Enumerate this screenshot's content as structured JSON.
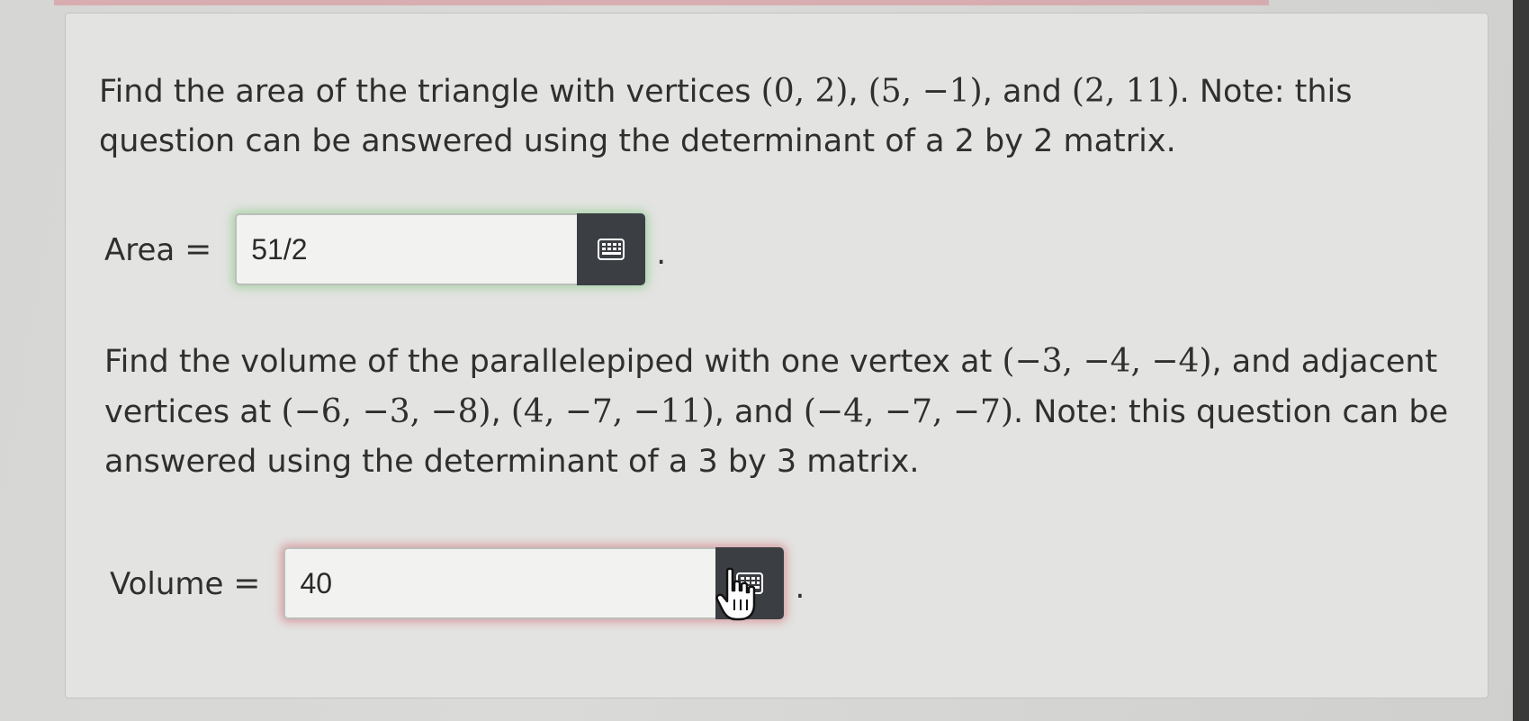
{
  "question1": {
    "t1": "Find the area of the triangle with vertices ",
    "v1": "(0, 2)",
    "t2": ", ",
    "v2": "(5, −1)",
    "t3": ", and ",
    "v3": "(2, 11)",
    "t4": ". Note: this question can be answered using the determinant of a 2 by 2 matrix.",
    "label": "Area",
    "equals": "=",
    "answer_value": "51/2",
    "period": "."
  },
  "question2": {
    "t1": "Find the volume of the parallelepiped with one vertex at ",
    "v1": "(−3, −4, −4)",
    "t2": ", and adjacent vertices at ",
    "v2": "(−6, −3, −8)",
    "t3": ", ",
    "v3": "(4, −7, −11)",
    "t4": ", and ",
    "v4": "(−4, −7, −7)",
    "t5": ". Note: this question can be answered using the determinant of a 3 by 3 matrix.",
    "label": "Volume",
    "equals": "=",
    "answer_value": "40",
    "period": "."
  },
  "icons": {
    "keyboard": "keyboard-icon",
    "cursor": "pointer-hand-icon"
  },
  "colors": {
    "correct_glow": "#78c878",
    "incorrect_glow": "#d2646e",
    "button_bg": "#3b3f44"
  }
}
